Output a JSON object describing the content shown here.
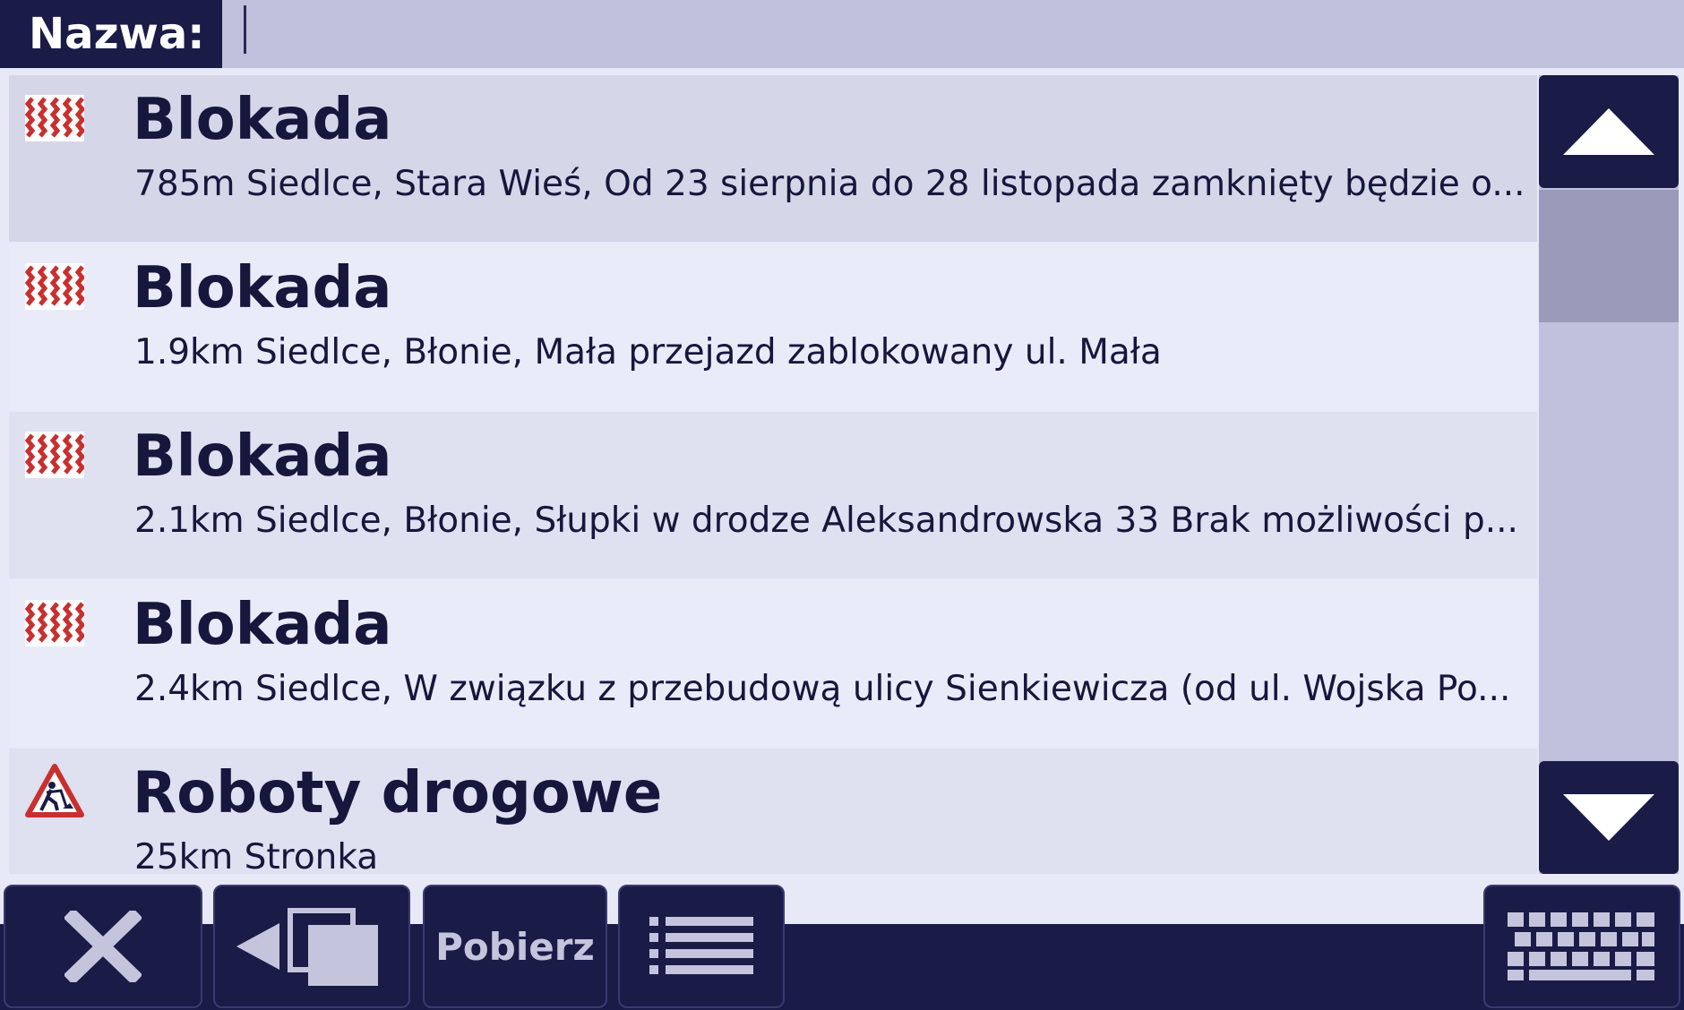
{
  "header": {
    "name_label": "Nazwa:",
    "name_value": ""
  },
  "items": [
    {
      "icon": "road-block-icon",
      "title": "Blokada",
      "desc": "785m Siedlce, Stara Wieś, Od 23 sierpnia do 28 listopada zamknięty będzie o..."
    },
    {
      "icon": "road-block-icon",
      "title": "Blokada",
      "desc": "1.9km Siedlce, Błonie, Mała przejazd zablokowany ul. Mała"
    },
    {
      "icon": "road-block-icon",
      "title": "Blokada",
      "desc": "2.1km Siedlce, Błonie, Słupki w drodze Aleksandrowska 33 Brak możliwości p..."
    },
    {
      "icon": "road-block-icon",
      "title": "Blokada",
      "desc": "2.4km Siedlce, W związku z przebudową ulicy Sienkiewicza (od ul. Wojska Po..."
    },
    {
      "icon": "roadworks-icon",
      "title": "Roboty drogowe",
      "desc": "25km Stronka"
    }
  ],
  "toolbar": {
    "pobierz_label": "Pobierz"
  },
  "colors": {
    "dark": "#1b1b48",
    "accent_red": "#c8302f",
    "selected_row": "#d5d6e8"
  }
}
